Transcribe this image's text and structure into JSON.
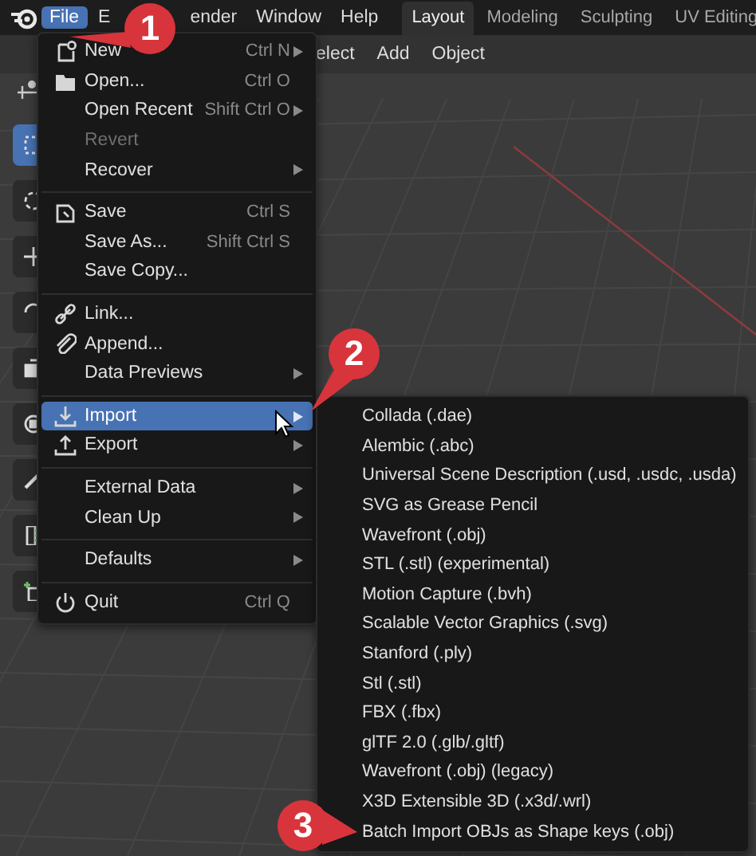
{
  "menubar": {
    "menus": [
      {
        "label": "File",
        "selected": true
      },
      {
        "label": "E",
        "selected": false
      },
      {
        "label": "ender",
        "selected": false
      },
      {
        "label": "Window",
        "selected": false
      },
      {
        "label": "Help",
        "selected": false
      }
    ]
  },
  "workspaces": [
    {
      "label": "Layout",
      "selected": true
    },
    {
      "label": "Modeling",
      "selected": false
    },
    {
      "label": "Sculpting",
      "selected": false
    },
    {
      "label": "UV Editing",
      "selected": false
    }
  ],
  "viewport_header": {
    "items": [
      "elect",
      "Add",
      "Object"
    ]
  },
  "toolbar": {
    "tools": [
      {
        "kind": "select",
        "selected": true
      },
      {
        "kind": "cursor",
        "selected": false
      },
      {
        "kind": "move",
        "selected": false
      },
      {
        "kind": "rotate",
        "selected": false
      },
      {
        "kind": "scale",
        "selected": false
      },
      {
        "kind": "transform",
        "selected": false
      },
      {
        "kind": "annotate",
        "selected": false
      },
      {
        "kind": "measure",
        "selected": false
      },
      {
        "kind": "add",
        "selected": false
      }
    ]
  },
  "file_menu": {
    "sections": [
      [
        {
          "label": "New",
          "kind": "new",
          "shortcut": "Ctrl N",
          "submenu": true,
          "disabled": false,
          "selected": false
        },
        {
          "label": "Open...",
          "kind": "folder",
          "shortcut": "Ctrl O",
          "submenu": false,
          "disabled": false,
          "selected": false
        },
        {
          "label": "Open Recent",
          "shortcut": "Shift Ctrl O",
          "submenu": true,
          "disabled": false,
          "selected": false
        },
        {
          "label": "Revert",
          "submenu": false,
          "disabled": true,
          "selected": false
        },
        {
          "label": "Recover",
          "submenu": true,
          "disabled": false,
          "selected": false
        }
      ],
      [
        {
          "label": "Save",
          "kind": "save",
          "shortcut": "Ctrl S",
          "submenu": false,
          "disabled": false,
          "selected": false
        },
        {
          "label": "Save As...",
          "shortcut": "Shift Ctrl S",
          "submenu": false,
          "disabled": false,
          "selected": false
        },
        {
          "label": "Save Copy...",
          "submenu": false,
          "disabled": false,
          "selected": false
        }
      ],
      [
        {
          "label": "Link...",
          "kind": "link",
          "submenu": false,
          "disabled": false,
          "selected": false
        },
        {
          "label": "Append...",
          "kind": "append",
          "submenu": false,
          "disabled": false,
          "selected": false
        },
        {
          "label": "Data Previews",
          "submenu": true,
          "disabled": false,
          "selected": false
        }
      ],
      [
        {
          "label": "Import",
          "kind": "import",
          "submenu": true,
          "disabled": false,
          "selected": true
        },
        {
          "label": "Export",
          "kind": "export",
          "submenu": true,
          "disabled": false,
          "selected": false
        }
      ],
      [
        {
          "label": "External Data",
          "submenu": true,
          "disabled": false,
          "selected": false
        },
        {
          "label": "Clean Up",
          "submenu": true,
          "disabled": false,
          "selected": false
        }
      ],
      [
        {
          "label": "Defaults",
          "submenu": true,
          "disabled": false,
          "selected": false
        }
      ],
      [
        {
          "label": "Quit",
          "kind": "power",
          "shortcut": "Ctrl Q",
          "submenu": false,
          "disabled": false,
          "selected": false
        }
      ]
    ]
  },
  "import_menu": {
    "items": [
      "Collada (.dae)",
      "Alembic (.abc)",
      "Universal Scene Description (.usd, .usdc, .usda)",
      "SVG as Grease Pencil",
      "Wavefront (.obj)",
      "STL (.stl) (experimental)",
      "Motion Capture (.bvh)",
      "Scalable Vector Graphics (.svg)",
      "Stanford (.ply)",
      "Stl (.stl)",
      "FBX (.fbx)",
      "glTF 2.0 (.glb/.gltf)",
      "Wavefront (.obj) (legacy)",
      "X3D Extensible 3D (.x3d/.wrl)",
      "Batch Import OBJs as Shape keys (.obj)"
    ]
  },
  "callouts": [
    {
      "number": "1"
    },
    {
      "number": "2"
    },
    {
      "number": "3"
    }
  ]
}
